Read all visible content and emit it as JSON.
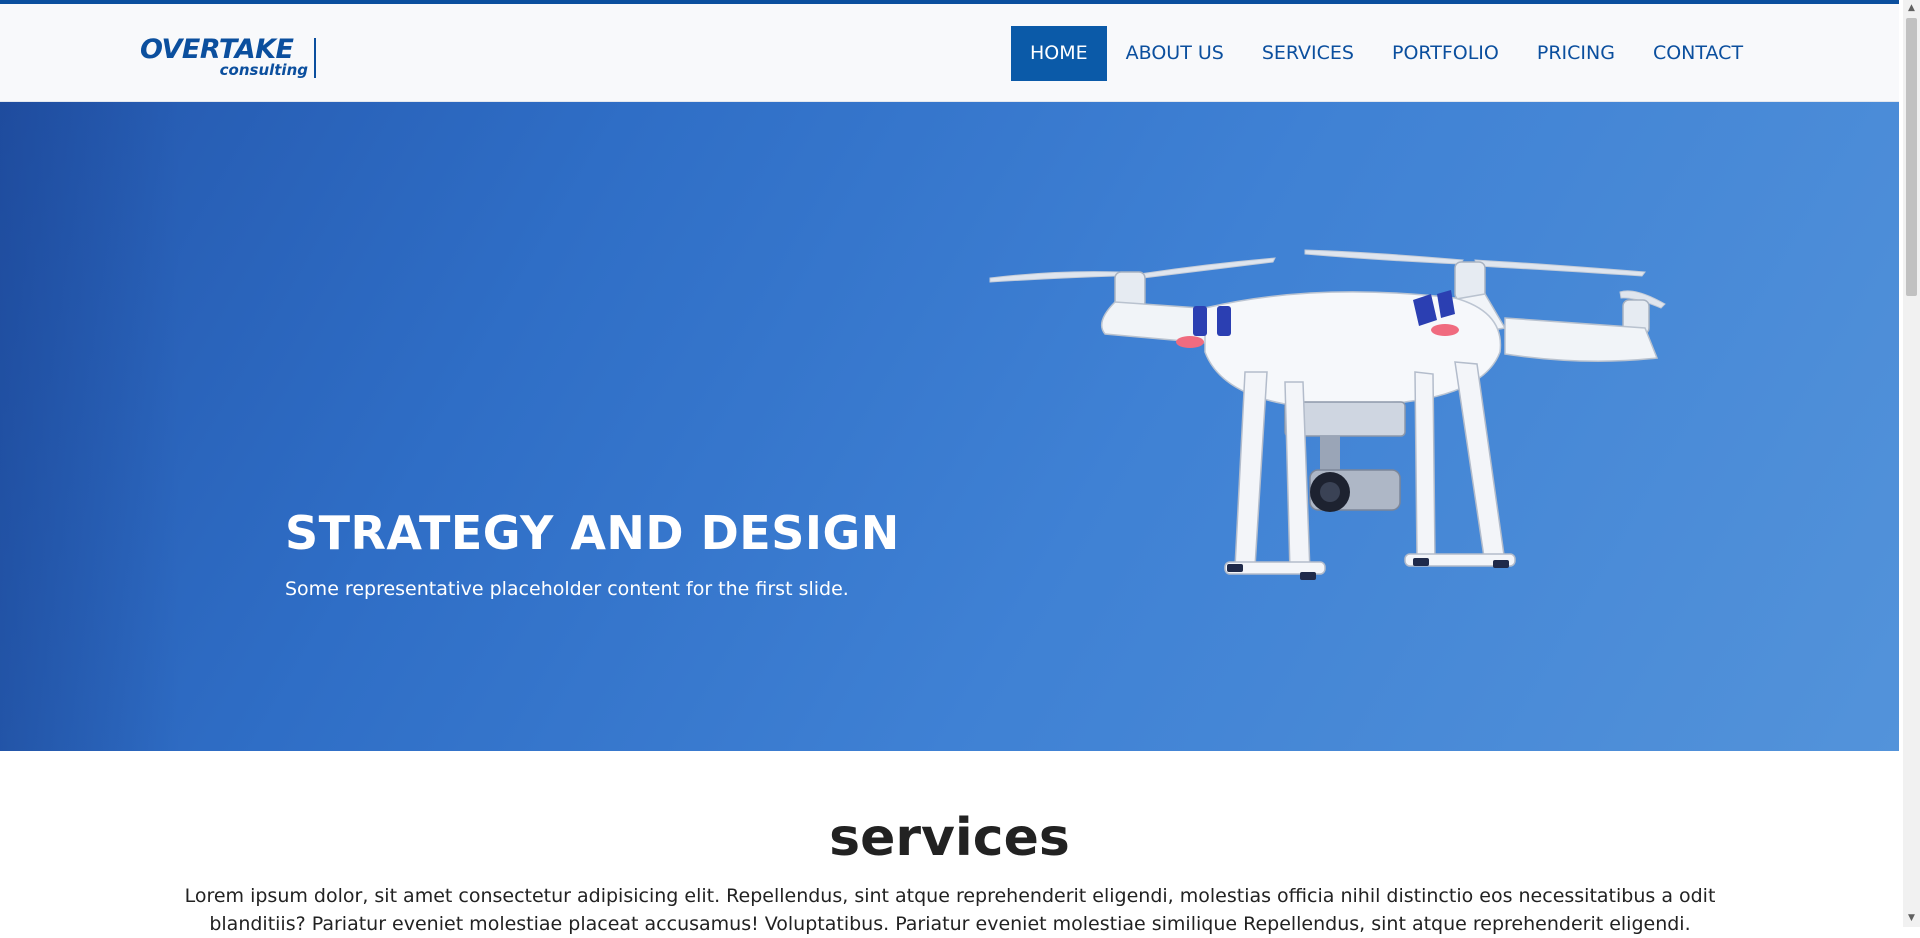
{
  "brand": {
    "name": "OVERTAKE",
    "tagline": "consulting",
    "color": "#0b4f9e"
  },
  "nav": {
    "items": [
      {
        "label": "HOME",
        "active": true
      },
      {
        "label": "ABOUT US",
        "active": false
      },
      {
        "label": "SERVICES",
        "active": false
      },
      {
        "label": "PORTFOLIO",
        "active": false
      },
      {
        "label": "PRICING",
        "active": false
      },
      {
        "label": "CONTACT",
        "active": false
      }
    ]
  },
  "hero": {
    "title": "STRATEGY AND DESIGN",
    "caption": "Some representative placeholder content for the first slide.",
    "image": "drone-image"
  },
  "services": {
    "title": "services",
    "text": "Lorem ipsum dolor, sit amet consectetur adipisicing elit. Repellendus, sint atque reprehenderit eligendi, molestias officia nihil distinctio eos necessitatibus a odit blanditiis? Pariatur eveniet molestiae placeat accusamus! Voluptatibus. Pariatur eveniet molestiae similique Repellendus, sint atque reprehenderit eligendi."
  },
  "colors": {
    "accent": "#0b5aa8",
    "hero_start": "#2457ad",
    "hero_end": "#5393da"
  }
}
